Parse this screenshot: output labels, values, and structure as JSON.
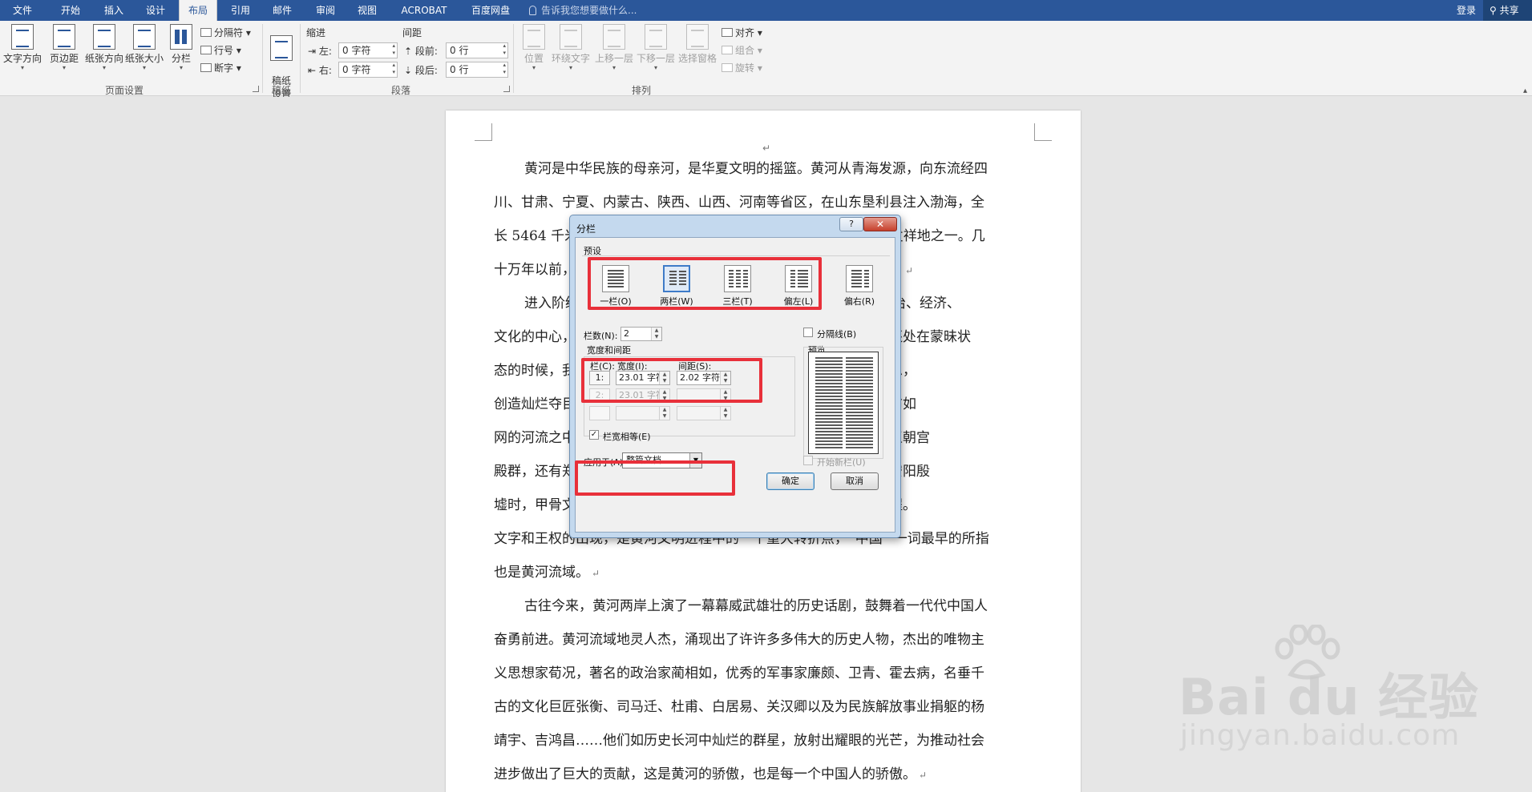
{
  "tabs": [
    "文件",
    "开始",
    "插入",
    "设计",
    "布局",
    "引用",
    "邮件",
    "审阅",
    "视图",
    "ACROBAT",
    "百度网盘"
  ],
  "active_tab": "布局",
  "tell_me": "告诉我您想要做什么...",
  "login": "登录",
  "share": "共享",
  "ribbon": {
    "page_setup": {
      "text_direction": "文字方向",
      "margins": "页边距",
      "orientation": "纸张方向",
      "size": "纸张大小",
      "columns": "分栏",
      "breaks": "分隔符",
      "line_numbers": "行号",
      "hyphenation": "断字",
      "group_label": "页面设置"
    },
    "manuscript": {
      "button": "稿纸\n设置",
      "group_label": "稿纸"
    },
    "paragraph": {
      "indent": "缩进",
      "spacing": "间距",
      "left": "左:",
      "right": "右:",
      "before": "段前:",
      "after": "段后:",
      "left_val": "0 字符",
      "right_val": "0 字符",
      "before_val": "0 行",
      "after_val": "0 行",
      "group_label": "段落"
    },
    "arrange": {
      "position": "位置",
      "wrap": "环绕文字",
      "forward": "上移一层",
      "backward": "下移一层",
      "pane": "选择窗格",
      "align": "对齐",
      "group": "组合",
      "rotate": "旋转",
      "group_label": "排列"
    }
  },
  "document": {
    "paragraphs": [
      {
        "lines": [
          "黄河是中华民族的母亲河，是华夏文明的摇篮。黄河从青海发源，向东流经四",
          "川、甘肃、宁夏、内蒙古、陕西、山西、河南等省区，在山东垦利县注入渤海，全",
          "长 5464 千米，流域面积 75.2 万平方千米，是中华文明最主要的发祥地之一。几",
          "十万年以前，人类就在这里生息繁衍，在黄河流域都位于黄河沿岸。"
        ]
      },
      {
        "lines": [
          "进入阶级社会以后，在很长的时间里，黄河流域一直是我国政治、经济、",
          "文化的中心，中国历史上的一些朝代都建都于此，当世界各地大都还处在蒙昧状",
          "态的时候，我们的祖先就在这块土地上繁衍生息，辟蒿莱，劳动生息，",
          "创造灿烂夺目的黄河文化。黄河流域人口稠密，沟渠密布，阜有密布如",
          "网的河流之中，在河南偃师二里头发现的，据认为是华夏文明的夏王朝宫",
          "殿群，还有郑州商城遗址以及殷墟遗址。在这里，从商王朝迁徙到安阳殷",
          "墟时，甲骨文的出现，反映了中国文字的发展和中国政权的演化过程。",
          "文字和王权的出现，是黄河文明进程中的一个重大转折点，“中国” 一词最早的所指",
          "也是黄河流域。"
        ]
      },
      {
        "lines": [
          "古往今来，黄河两岸上演了一幕幕威武雄壮的历史话剧，鼓舞着一代代中国人",
          "奋勇前进。黄河流域地灵人杰，涌现出了许许多多伟大的历史人物，杰出的唯物主",
          "义思想家荀况，著名的政治家蔺相如，优秀的军事家廉颇、卫青、霍去病，名垂千",
          "古的文化巨匠张衡、司马迁、杜甫、白居易、关汉卿以及为民族解放事业捐躯的杨",
          "靖宇、吉鸿昌……他们如历史长河中灿烂的群星，放射出耀眼的光芒，为推动社会",
          "进步做出了巨大的贡献，这是黄河的骄傲，也是每一个中国人的骄傲。"
        ]
      }
    ]
  },
  "dialog": {
    "title": "分栏",
    "help": "?",
    "close": "✕",
    "presets_label": "预设",
    "presets": [
      "一栏(O)",
      "两栏(W)",
      "三栏(T)",
      "偏左(L)",
      "偏右(R)"
    ],
    "selected_preset": "两栏(W)",
    "num_cols_label": "栏数(N):",
    "num_cols": "2",
    "line_between": "分隔线(B)",
    "width_spacing_label": "宽度和间距",
    "preview_label": "预览",
    "col_header": "栏(C):",
    "width_header": "宽度(I):",
    "spacing_header": "间距(S):",
    "rows": [
      {
        "n": "1:",
        "width": "23.01 字符",
        "spacing": "2.02 字符"
      },
      {
        "n": "2:",
        "width": "23.01 字符",
        "spacing": ""
      },
      {
        "n": "",
        "width": "",
        "spacing": ""
      }
    ],
    "equal_width": "栏宽相等(E)",
    "apply_to_label": "应用于(A):",
    "apply_to": "整篇文档",
    "start_new_col": "开始新栏(U)",
    "ok": "确定",
    "cancel": "取消"
  },
  "watermark": {
    "logo_text": "Bai du 经验",
    "url": "jingyan.baidu.com"
  }
}
